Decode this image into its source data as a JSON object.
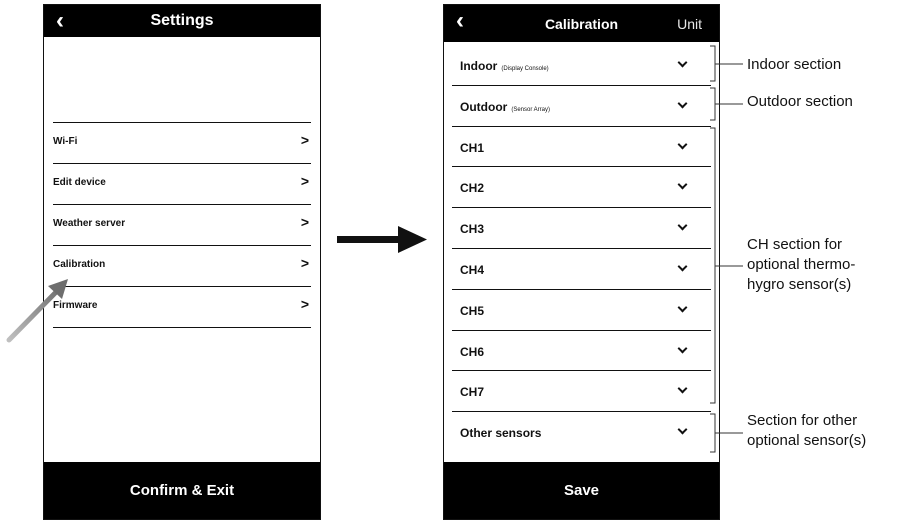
{
  "settings_screen": {
    "back_icon": "chevron-left-icon",
    "title": "Settings",
    "menu": [
      {
        "label": "Wi-Fi"
      },
      {
        "label": "Edit device"
      },
      {
        "label": "Weather server"
      },
      {
        "label": "Calibration"
      },
      {
        "label": "Firmware"
      }
    ],
    "confirm_label": "Confirm & Exit"
  },
  "calibration_screen": {
    "back_icon": "chevron-left-icon",
    "title": "Calibration",
    "unit_label": "Unit",
    "rows": [
      {
        "label": "Indoor",
        "sub": "(Display Console)"
      },
      {
        "label": "Outdoor",
        "sub": "(Sensor Array)"
      },
      {
        "label": "CH1",
        "sub": ""
      },
      {
        "label": "CH2",
        "sub": ""
      },
      {
        "label": "CH3",
        "sub": ""
      },
      {
        "label": "CH4",
        "sub": ""
      },
      {
        "label": "CH5",
        "sub": ""
      },
      {
        "label": "CH6",
        "sub": ""
      },
      {
        "label": "CH7",
        "sub": ""
      },
      {
        "label": "Other sensors",
        "sub": ""
      }
    ],
    "save_label": "Save"
  },
  "annotations": {
    "indoor": "Indoor section",
    "outdoor": "Outdoor section",
    "ch_line1": "CH section for",
    "ch_line2": "optional thermo-",
    "ch_line3": "hygro sensor(s)",
    "other_line1": "Section for other",
    "other_line2": "optional sensor(s)"
  }
}
